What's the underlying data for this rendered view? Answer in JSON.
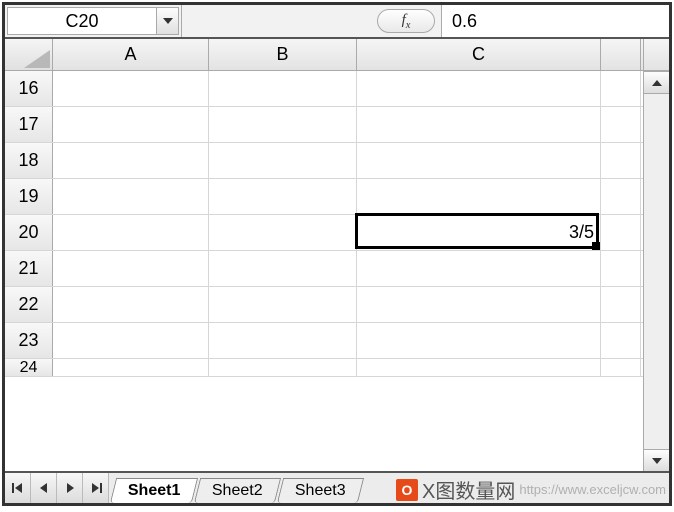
{
  "name_box": "C20",
  "formula_value": "0.6",
  "columns": {
    "a": "A",
    "b": "B",
    "c": "C"
  },
  "rows": [
    {
      "num": "16",
      "c": ""
    },
    {
      "num": "17",
      "c": ""
    },
    {
      "num": "18",
      "c": ""
    },
    {
      "num": "19",
      "c": ""
    },
    {
      "num": "20",
      "c": "3/5"
    },
    {
      "num": "21",
      "c": ""
    },
    {
      "num": "22",
      "c": ""
    },
    {
      "num": "23",
      "c": ""
    },
    {
      "num": "24",
      "c": ""
    }
  ],
  "selected_row_index": 4,
  "tabs": [
    {
      "label": "Sheet1",
      "active": true
    },
    {
      "label": "Sheet2",
      "active": false
    },
    {
      "label": "Sheet3",
      "active": false
    }
  ],
  "fx_label": "fx",
  "watermark": {
    "logo_text": "O",
    "main": "X图数量网",
    "url": "https://www.exceljcw.com"
  }
}
